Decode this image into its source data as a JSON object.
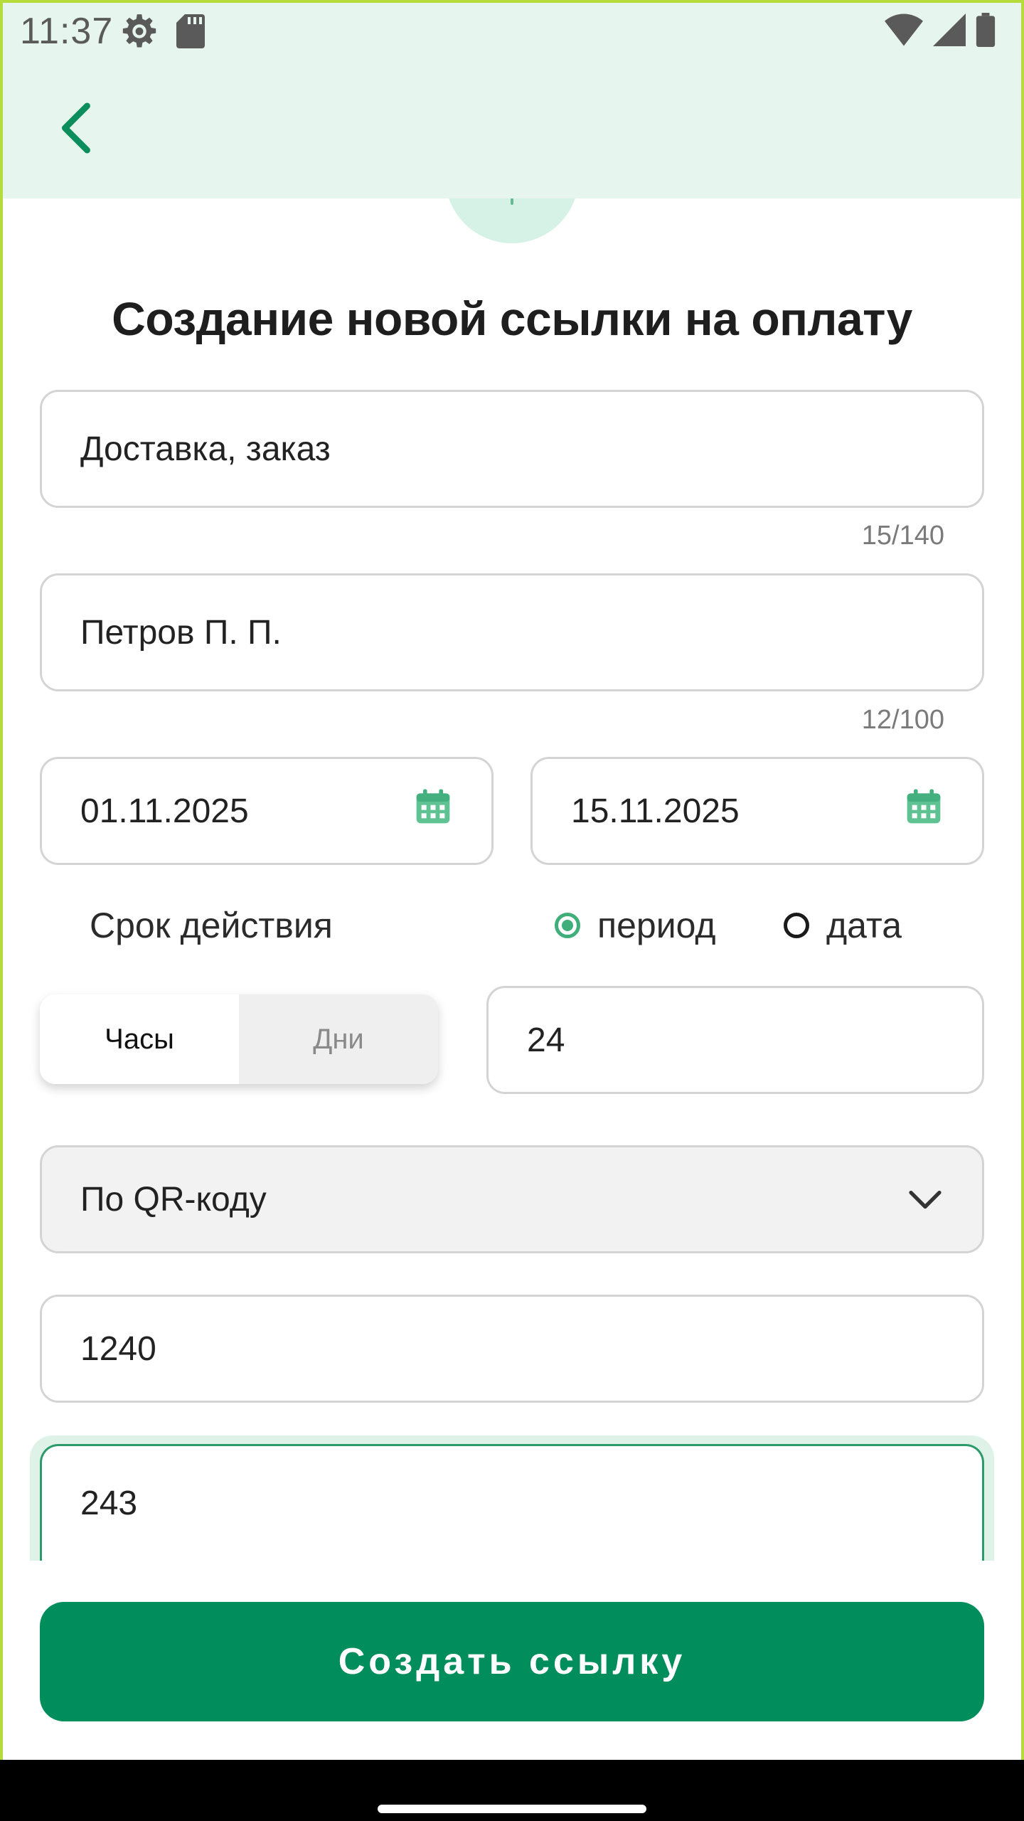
{
  "status_bar": {
    "time": "11:37"
  },
  "title": "Создание новой ссылки на оплату",
  "fields": {
    "purpose": {
      "value": "Доставка, заказ",
      "counter": "15/140"
    },
    "payer": {
      "value": "Петров П. П.",
      "counter": "12/100"
    },
    "date_from": {
      "value": "01.11.2025"
    },
    "date_to": {
      "value": "15.11.2025"
    },
    "period_amount": {
      "value": "24"
    },
    "amount": {
      "value": "1240"
    },
    "order_number": {
      "value": "243"
    }
  },
  "validity": {
    "label": "Срок действия",
    "option_period": "период",
    "option_date": "дата",
    "selected": "период"
  },
  "unit_toggle": {
    "hours": "Часы",
    "days": "Дни",
    "selected": "Часы"
  },
  "payment_method": {
    "selected": "По QR-коду"
  },
  "create_button": "Создать ссылку",
  "colors": {
    "accent": "#028d5c",
    "accent_light": "#3fae7b",
    "app_bar": "#e6f5ee",
    "frame": "#b6dc3c"
  }
}
